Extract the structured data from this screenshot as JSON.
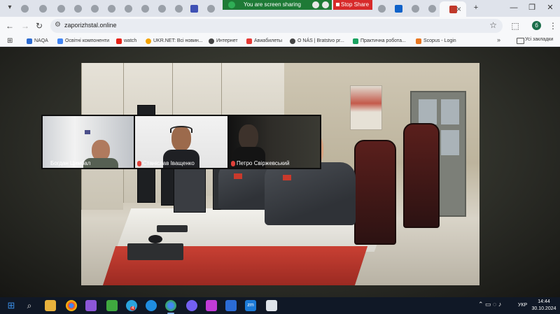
{
  "browser": {
    "url": "zaporizhstal.online",
    "profile_initial": "б",
    "win_minimize": "—",
    "win_maximize": "❐",
    "win_close": "✕",
    "new_tab": "+"
  },
  "screen_share": {
    "status": "You are screen sharing",
    "stop_label": "Stop Share"
  },
  "bookmarks": [
    {
      "label": "NAQA",
      "color": "#2d6bd1"
    },
    {
      "label": "Освітні компоненти",
      "color": "#4285f4"
    },
    {
      "label": "watch",
      "color": "#e62117"
    },
    {
      "label": "UKR.NET: Всі новин...",
      "color": "#f4a300"
    },
    {
      "label": "Интернет",
      "color": "#444444"
    },
    {
      "label": "Авиабилеты",
      "color": "#e53935"
    },
    {
      "label": "O NÁS | Bratstvo pr...",
      "color": "#444444"
    },
    {
      "label": "Практична робота...",
      "color": "#1aa260"
    },
    {
      "label": "Scopus - Login",
      "color": "#e87722"
    }
  ],
  "bookmarks_all": "Усі закладки",
  "participants": [
    {
      "name": "Богдан Цимбал",
      "muted": false
    },
    {
      "name": "Станіслав Іващенко",
      "muted": true
    },
    {
      "name": "Петро Свіржевський",
      "muted": true
    }
  ],
  "taskbar": {
    "language": "УКР",
    "time": "14:44",
    "date": "30.10.2024",
    "badge_count": "4"
  },
  "colors": {
    "share_green": "#1e7a36",
    "stop_red": "#d72a2a",
    "taskbar_bg": "#101826"
  }
}
